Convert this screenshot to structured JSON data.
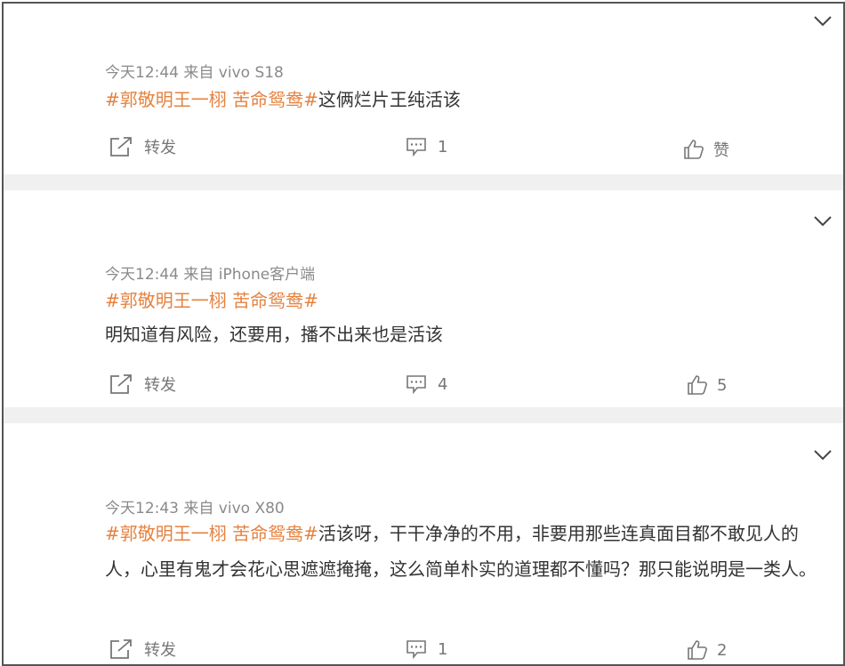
{
  "posts": [
    {
      "meta": "今天12:44 来自 vivo S18",
      "tag": "#郭敬明王一栩 苦命鸳鸯#",
      "text": "这俩烂片王纯活该",
      "repost_label": "转发",
      "comment_count": "1",
      "like_label": "赞"
    },
    {
      "meta": "今天12:44 来自 iPhone客户端",
      "tag": "#郭敬明王一栩 苦命鸳鸯#",
      "text": "明知道有风险，还要用，播不出来也是活该",
      "repost_label": "转发",
      "comment_count": "4",
      "like_label": "5"
    },
    {
      "meta": "今天12:43 来自 vivo X80",
      "tag": "#郭敬明王一栩 苦命鸳鸯#",
      "text": "活该呀，干干净净的不用，非要用那些连真面目都不敢见人的人，心里有鬼才会花心思遮遮掩掩，这么简单朴实的道理都不懂吗？那只能说明是一类人。",
      "repost_label": "转发",
      "comment_count": "1",
      "like_label": "2"
    }
  ],
  "icons": {
    "expand": "chevron-down-icon",
    "repost": "share-icon",
    "comment": "comment-icon",
    "like": "thumbs-up-icon"
  },
  "colors": {
    "topic_tag": "#e5823f",
    "meta_text": "#8a8a8a",
    "separator": "#f0f0f0"
  }
}
